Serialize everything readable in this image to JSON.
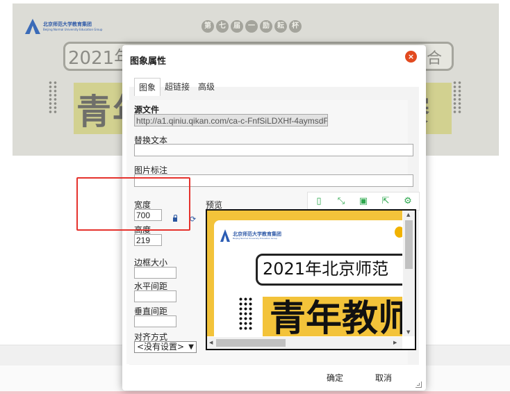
{
  "banner": {
    "org_name": "北京师范大学教育集团",
    "org_sub": "Beijing Normal University Education Group",
    "slogan": [
      "第",
      "七",
      "届",
      "一",
      "励",
      "耘",
      "杯"
    ],
    "year_text": "2021年",
    "year_tail": "合",
    "big_text": "青年",
    "big_tail": "賽"
  },
  "dialog": {
    "title": "图象属性",
    "close_symbol": "×",
    "tabs": [
      {
        "label": "图象",
        "active": true
      },
      {
        "label": "超链接",
        "active": false
      },
      {
        "label": "高级",
        "active": false
      }
    ],
    "source": {
      "label": "源文件",
      "value": "http://a1.qiniu.qikan.com/ca-c-FnfSiLDXHf-4aymsdF"
    },
    "alt_text": {
      "label": "替换文本",
      "value": ""
    },
    "caption": {
      "label": "图片标注",
      "value": ""
    },
    "width": {
      "label": "宽度",
      "value": "700"
    },
    "height": {
      "label": "高度",
      "value": "219"
    },
    "border": {
      "label": "边框大小",
      "value": ""
    },
    "hspace": {
      "label": "水平间距",
      "value": ""
    },
    "vspace": {
      "label": "垂直间距",
      "value": ""
    },
    "align": {
      "label": "对齐方式",
      "selected": "<没有设置>"
    },
    "preview_label": "预览",
    "preview_image": {
      "org_name": "北京师范大学教育集团",
      "org_sub": "Beijing Normal University Education Group",
      "year_text": "2021年北京师范",
      "big_text": "青年教师"
    },
    "ok_label": "确定",
    "cancel_label": "取消"
  },
  "toolbar_icons": [
    "fit-icon",
    "fullscreen-icon",
    "save-icon",
    "share-icon",
    "settings-icon"
  ],
  "colors": {
    "accent_red": "#e5322d",
    "close_orange": "#e24a1f",
    "toolbar_green": "#2fa84f",
    "banner_yellow": "#f3c33a"
  }
}
